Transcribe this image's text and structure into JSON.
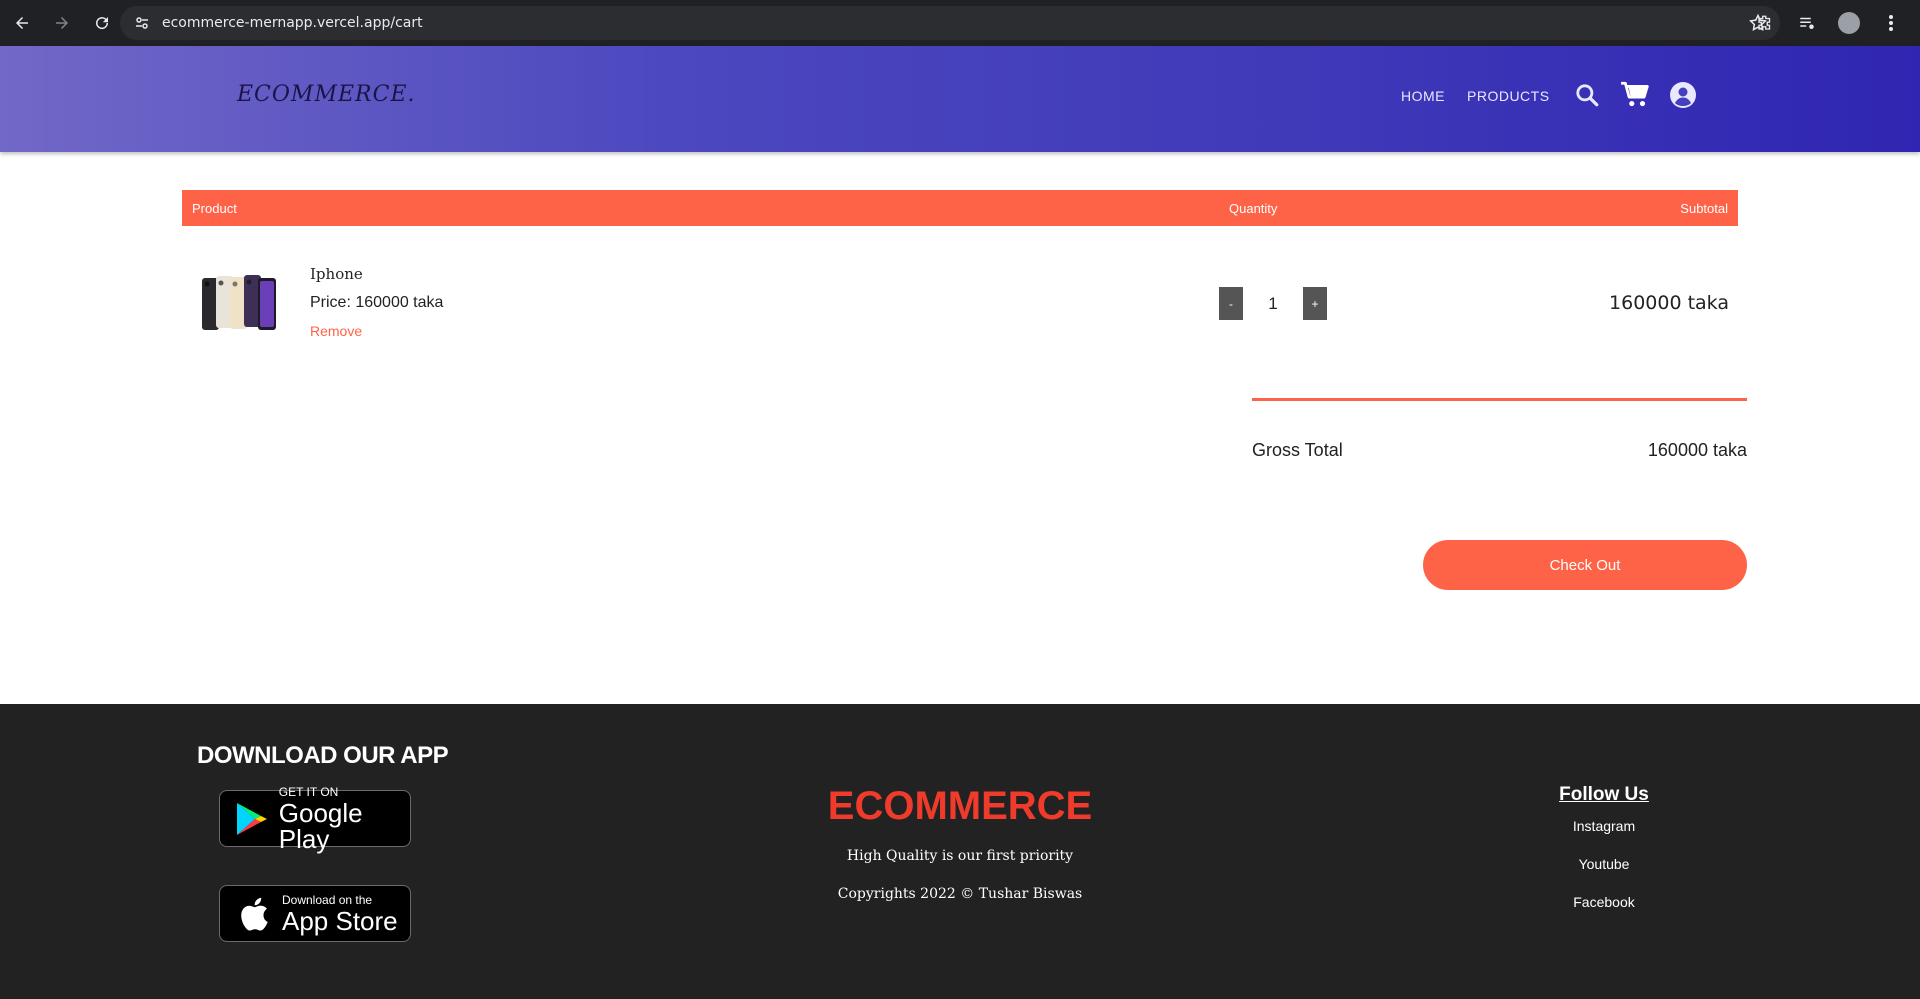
{
  "browser": {
    "url": "ecommerce-mernapp.vercel.app/cart"
  },
  "header": {
    "logo": "ECOMMERCE.",
    "menu": [
      {
        "label": "HOME"
      },
      {
        "label": "PRODUCTS"
      }
    ]
  },
  "cart": {
    "columns": {
      "product": "Product",
      "quantity": "Quantity",
      "subtotal": "Subtotal"
    },
    "items": [
      {
        "name": "Iphone",
        "price": "Price: 160000 taka",
        "remove_label": "Remove",
        "quantity": "1",
        "decrement_label": "-",
        "increment_label": "+",
        "subtotal": "160000 taka"
      }
    ],
    "gross_total_label": "Gross Total",
    "gross_total_value": "160000 taka",
    "checkout_label": "Check Out"
  },
  "footer": {
    "download_title": "DOWNLOAD OUR APP",
    "google_play": {
      "small": "GET IT ON",
      "big": "Google Play"
    },
    "app_store": {
      "small": "Download on the",
      "big": "App Store"
    },
    "brand": "ECOMMERCE",
    "tagline": "High Quality is our first priority",
    "copyright": "Copyrights 2022 © Tushar Biswas",
    "follow_title": "Follow Us",
    "social": [
      {
        "label": "Instagram"
      },
      {
        "label": "Youtube"
      },
      {
        "label": "Facebook"
      }
    ]
  },
  "colors": {
    "accent": "#ff6347",
    "header_start": "#7168c7",
    "header_end": "#2f25b2",
    "footer_bg": "#222222",
    "brand_red": "#ee3b2b"
  }
}
